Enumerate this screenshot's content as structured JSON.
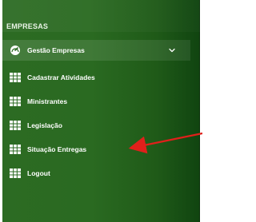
{
  "sidebar": {
    "section_title": "EMPRESAS",
    "items": [
      {
        "label": "Gestão Empresas",
        "icon": "dashboard-icon",
        "active": true,
        "has_chevron": true
      },
      {
        "label": "Cadastrar Atividades",
        "icon": "grid-icon"
      },
      {
        "label": "Ministrantes",
        "icon": "grid-icon"
      },
      {
        "label": "Legislação",
        "icon": "grid-icon"
      },
      {
        "label": "Situação Entregas",
        "icon": "grid-icon"
      },
      {
        "label": "Logout",
        "icon": "grid-icon"
      }
    ]
  },
  "annotation": {
    "type": "red-arrow",
    "color": "#e0201b",
    "points_to": "Situação Entregas"
  },
  "colors": {
    "sidebar_green": "#2a6a21",
    "text": "#ffffff"
  }
}
